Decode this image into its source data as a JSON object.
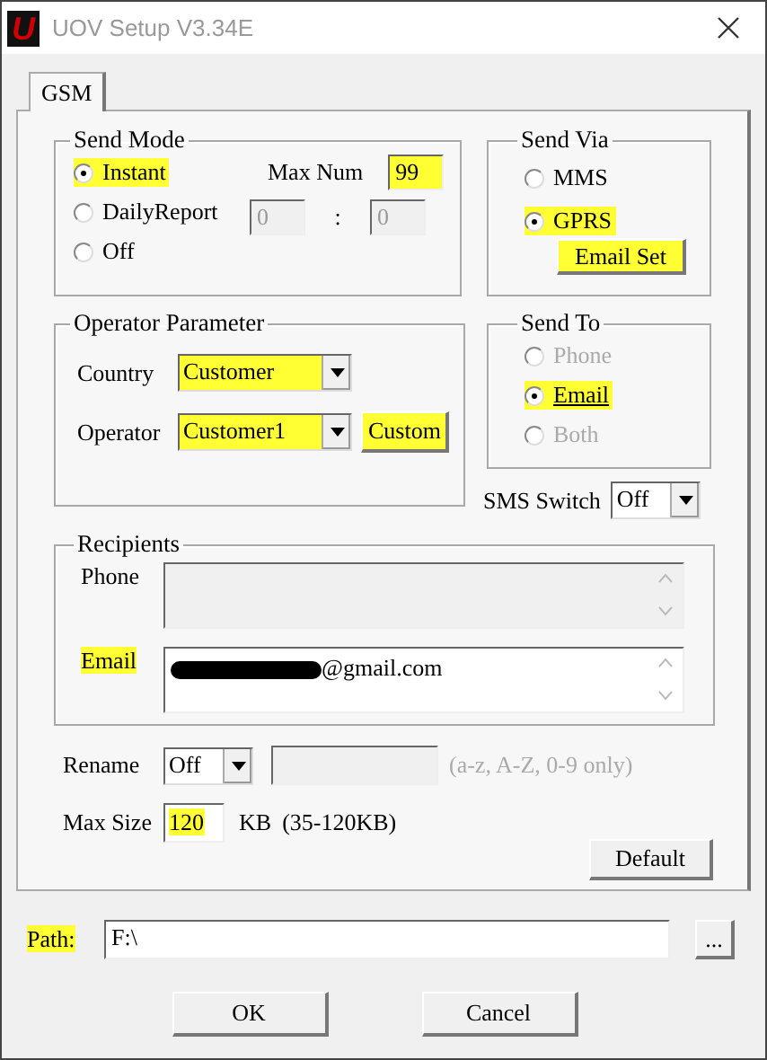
{
  "window": {
    "logo": "U",
    "title": "UOV Setup V3.34E"
  },
  "tabs": [
    {
      "label": "GSM",
      "selected": true
    }
  ],
  "send_mode": {
    "title": "Send Mode",
    "options": [
      {
        "label": "Instant",
        "selected": true,
        "highlighted": true
      },
      {
        "label": "DailyReport",
        "selected": false,
        "highlighted": false
      },
      {
        "label": "Off",
        "selected": false,
        "highlighted": false
      }
    ],
    "max_num_label": "Max Num",
    "max_num": {
      "value": "99",
      "highlighted": true
    },
    "daily_hour": {
      "value": "0",
      "disabled": true
    },
    "separator": ":",
    "daily_minute": {
      "value": "0",
      "disabled": true
    }
  },
  "send_via": {
    "title": "Send Via",
    "options": [
      {
        "label": "MMS",
        "selected": false,
        "highlighted": false
      },
      {
        "label": "GPRS",
        "selected": true,
        "highlighted": true
      }
    ],
    "email_set_button": {
      "label": "Email Set",
      "highlighted": true
    }
  },
  "operator_parameter": {
    "title": "Operator Parameter",
    "country": {
      "label": "Country",
      "value": "Customer",
      "highlighted": true
    },
    "operator": {
      "label": "Operator",
      "value": "Customer1",
      "highlighted": true
    },
    "custom_button": {
      "label": "Custom",
      "highlighted": true
    }
  },
  "send_to": {
    "title": "Send To",
    "options": [
      {
        "label": "Phone",
        "selected": false,
        "disabled": true,
        "highlighted": false
      },
      {
        "label": "Email",
        "selected": true,
        "disabled": false,
        "highlighted": true
      },
      {
        "label": "Both",
        "selected": false,
        "disabled": true,
        "highlighted": false
      }
    ]
  },
  "sms_switch": {
    "label": "SMS Switch",
    "value": "Off"
  },
  "recipients": {
    "title": "Recipients",
    "phone": {
      "label": "Phone",
      "highlighted": false,
      "disabled": true
    },
    "email": {
      "label": "Email",
      "highlighted": true,
      "redacted": true,
      "value": "@gmail.com"
    }
  },
  "rename": {
    "label": "Rename",
    "value": "Off",
    "name_disabled": true,
    "hint": "(a-z, A-Z, 0-9 only)"
  },
  "max_size": {
    "label": "Max Size",
    "value": "120",
    "highlighted": true,
    "unit": "KB",
    "range": "(35-120KB)"
  },
  "default_button": "Default",
  "path": {
    "label": "Path:",
    "highlighted": true,
    "value": "F:\\",
    "browse_button": "..."
  },
  "buttons": [
    "OK",
    "Cancel"
  ]
}
